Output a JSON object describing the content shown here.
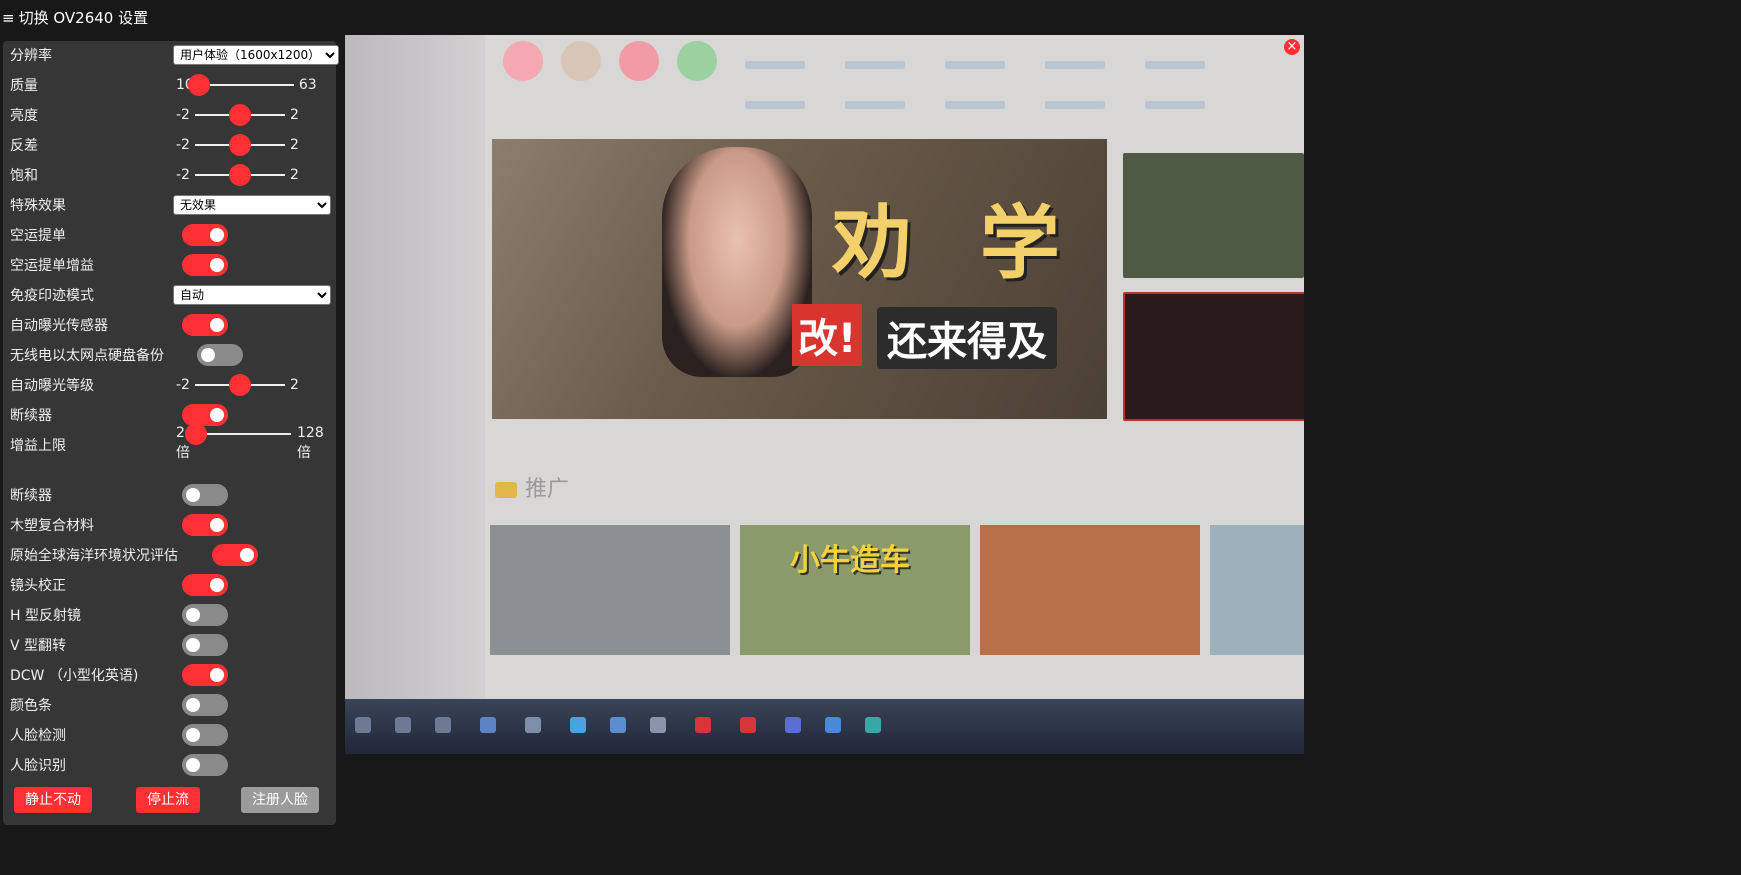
{
  "header": {
    "menu_icon": "≡",
    "title": "切换 OV2640 设置"
  },
  "settings": {
    "resolution": {
      "label": "分辨率",
      "value": "用户体验（1600x1200）"
    },
    "quality": {
      "label": "质量",
      "min": "10",
      "max": "63",
      "level": 0
    },
    "brightness": {
      "label": "亮度",
      "min": "-2",
      "max": "2",
      "level": 0.5
    },
    "contrast": {
      "label": "反差",
      "min": "-2",
      "max": "2",
      "level": 0.5
    },
    "saturation": {
      "label": "饱和",
      "min": "-2",
      "max": "2",
      "level": 0.5
    },
    "special_effect": {
      "label": "特殊效果",
      "value": "无效果"
    },
    "awb": {
      "label": "空运提单",
      "on": true
    },
    "awb_gain": {
      "label": "空运提单增益",
      "on": true
    },
    "wb_mode": {
      "label": "免疫印迹模式",
      "value": "自动"
    },
    "aec_sensor": {
      "label": "自动曝光传感器",
      "on": true
    },
    "aec_dsp": {
      "label": "无线电以太网点硬盘备份",
      "on": false
    },
    "ae_level": {
      "label": "自动曝光等级",
      "min": "-2",
      "max": "2",
      "level": 0.5
    },
    "agc": {
      "label": "断续器",
      "on": true
    },
    "gain_ceiling": {
      "label": "增益上限",
      "min": "2",
      "min_unit": "倍",
      "max": "128",
      "max_unit": "倍",
      "level": 0
    },
    "bpc": {
      "label": "断续器",
      "on": false
    },
    "wpc": {
      "label": "木塑复合材料",
      "on": true
    },
    "raw_gma": {
      "label": "原始全球海洋环境状况评估",
      "on": true
    },
    "lenc": {
      "label": "镜头校正",
      "on": true
    },
    "hmirror": {
      "label": "H 型反射镜",
      "on": false
    },
    "vflip": {
      "label": "V 型翻转",
      "on": false
    },
    "dcw": {
      "label": "DCW （小型化英语)",
      "on": true
    },
    "colorbar": {
      "label": "颜色条",
      "on": false
    },
    "face_detect": {
      "label": "人脸检测",
      "on": false
    },
    "face_recognize": {
      "label": "人脸识别",
      "on": false
    }
  },
  "buttons": {
    "still": "静止不动",
    "stop_stream": "停止流",
    "enroll_face": "注册人脸"
  },
  "stream": {
    "close_icon": "×",
    "banner_text_1": "劝 学",
    "banner_text_2": "改!",
    "banner_text_3": "还来得及",
    "section_label": "推广",
    "thumb2_title": "小牛造车"
  },
  "colors": {
    "accent": "#ff3034",
    "panel": "#363636",
    "background": "#181818",
    "toggle_off": "#8a8a8a"
  }
}
